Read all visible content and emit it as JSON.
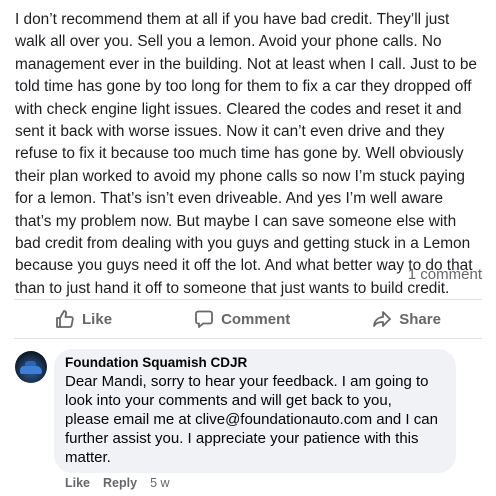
{
  "post": {
    "lines": [
      "I don’t recommend them at all if you have bad credit. They’ll just",
      "walk all over you. Sell you a lemon. Avoid your phone calls. No",
      "management ever in the building. Not at least when I call.  Just to be",
      "told time has gone by too long for them to fix a car they dropped off",
      "with check engine light issues.  Cleared the codes and reset it and",
      "sent it back with worse issues. Now it can’t even drive and they",
      "refuse to fix it because too much time has gone by. Well obviously",
      "their plan worked to avoid my phone calls so now I’m stuck paying",
      "for a lemon. That’s isn’t even driveable.  And yes I’m well aware",
      "that’s my problem now. But maybe I can save someone else with",
      "bad credit from dealing with you guys and getting stuck in a Lemon",
      "because you guys need it off the lot. And what better way to do that",
      "than to just hand it off to someone that just wants to build credit."
    ],
    "comment_count": "1 comment"
  },
  "actions": {
    "like": "Like",
    "comment": "Comment",
    "share": "Share"
  },
  "comment": {
    "author": "Foundation Squamish CDJR",
    "lines": [
      "Dear Mandi, sorry to hear your feedback. I am going to",
      "look into your comments and will get back to you,",
      "please email me at clive@foundationauto.com and I can",
      "further assist you. I appreciate your patience with this",
      "matter."
    ],
    "like_label": "Like",
    "reply_label": "Reply",
    "time": "5 w"
  },
  "icons": {
    "like": "thumbs-up-icon",
    "comment": "comment-bubble-icon",
    "share": "share-arrow-icon"
  },
  "colors": {
    "secondary_text": "#65676b",
    "bubble_bg": "#f0f2f5"
  }
}
